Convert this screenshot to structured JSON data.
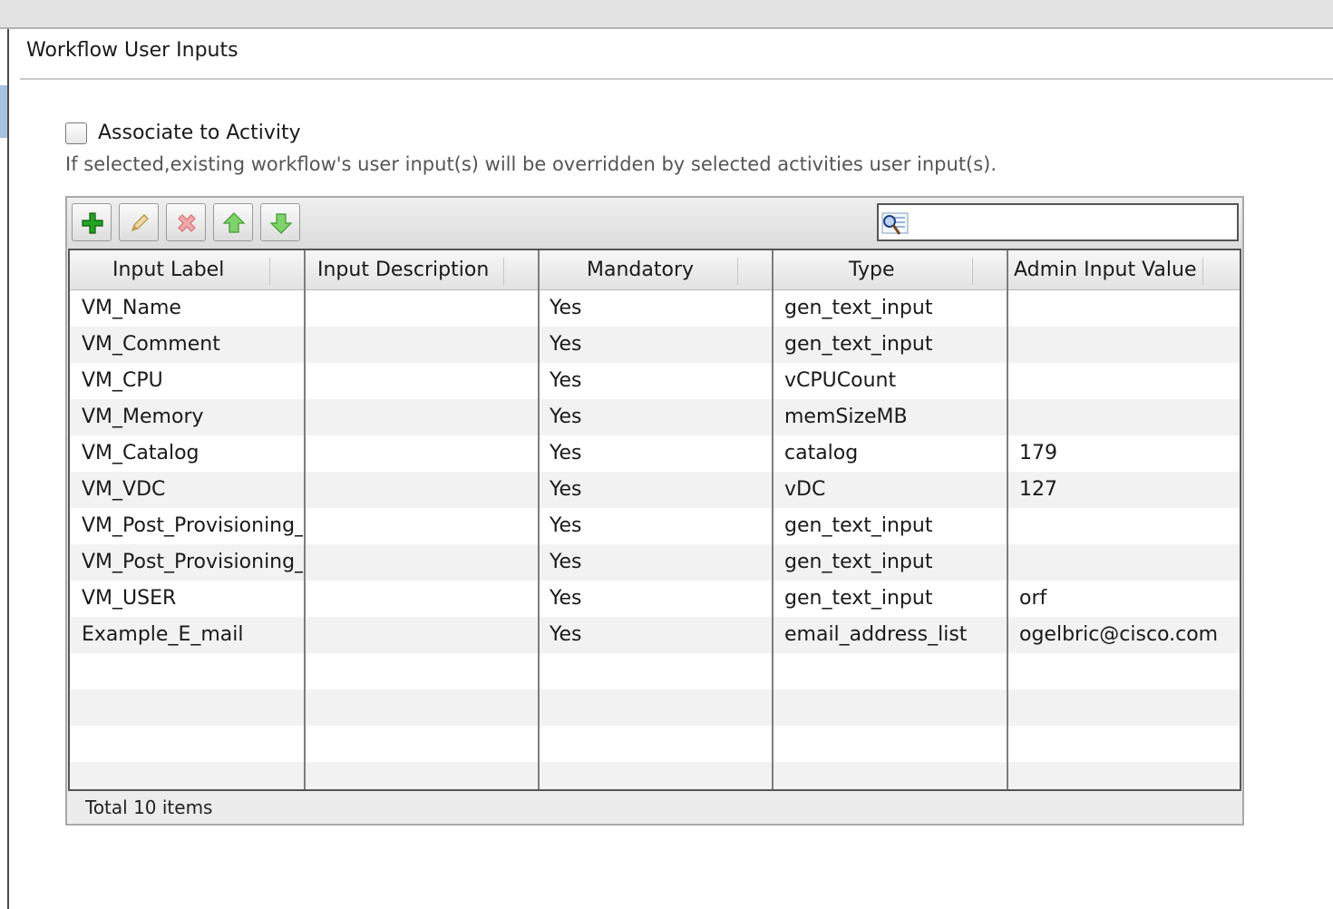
{
  "panel": {
    "title": "Workflow User Inputs"
  },
  "associate": {
    "label": "Associate to Activity",
    "checked": false,
    "help": "If selected,existing workflow's user input(s) will be overridden by selected activities user input(s)."
  },
  "toolbar": {
    "buttons": [
      {
        "name": "add",
        "icon": "plus-icon",
        "color": "#1f9a1f"
      },
      {
        "name": "edit",
        "icon": "pencil-icon",
        "color": "#c9a24a"
      },
      {
        "name": "delete",
        "icon": "delete-x-icon",
        "color": "#e08a8a"
      },
      {
        "name": "move-up",
        "icon": "arrow-up-icon",
        "color": "#5cbf4a"
      },
      {
        "name": "move-down",
        "icon": "arrow-down-icon",
        "color": "#5cbf4a"
      }
    ],
    "search": {
      "value": "",
      "icon": "search-icon"
    }
  },
  "table": {
    "columns": [
      "Input Label",
      "Input Description",
      "Mandatory",
      "Type",
      "Admin Input Value"
    ],
    "rows": [
      [
        "VM_Name",
        "",
        "Yes",
        "gen_text_input",
        ""
      ],
      [
        "VM_Comment",
        "",
        "Yes",
        "gen_text_input",
        ""
      ],
      [
        "VM_CPU",
        "",
        "Yes",
        "vCPUCount",
        ""
      ],
      [
        "VM_Memory",
        "",
        "Yes",
        "memSizeMB",
        ""
      ],
      [
        "VM_Catalog",
        "",
        "Yes",
        "catalog",
        "179"
      ],
      [
        "VM_VDC",
        "",
        "Yes",
        "vDC",
        "127"
      ],
      [
        "VM_Post_Provisioning_",
        "",
        "Yes",
        "gen_text_input",
        ""
      ],
      [
        "VM_Post_Provisioning_",
        "",
        "Yes",
        "gen_text_input",
        ""
      ],
      [
        "VM_USER",
        "",
        "Yes",
        "gen_text_input",
        "orf"
      ],
      [
        "Example_E_mail",
        "",
        "Yes",
        "email_address_list",
        "ogelbric@cisco.com"
      ]
    ],
    "footer": "Total 10 items"
  }
}
